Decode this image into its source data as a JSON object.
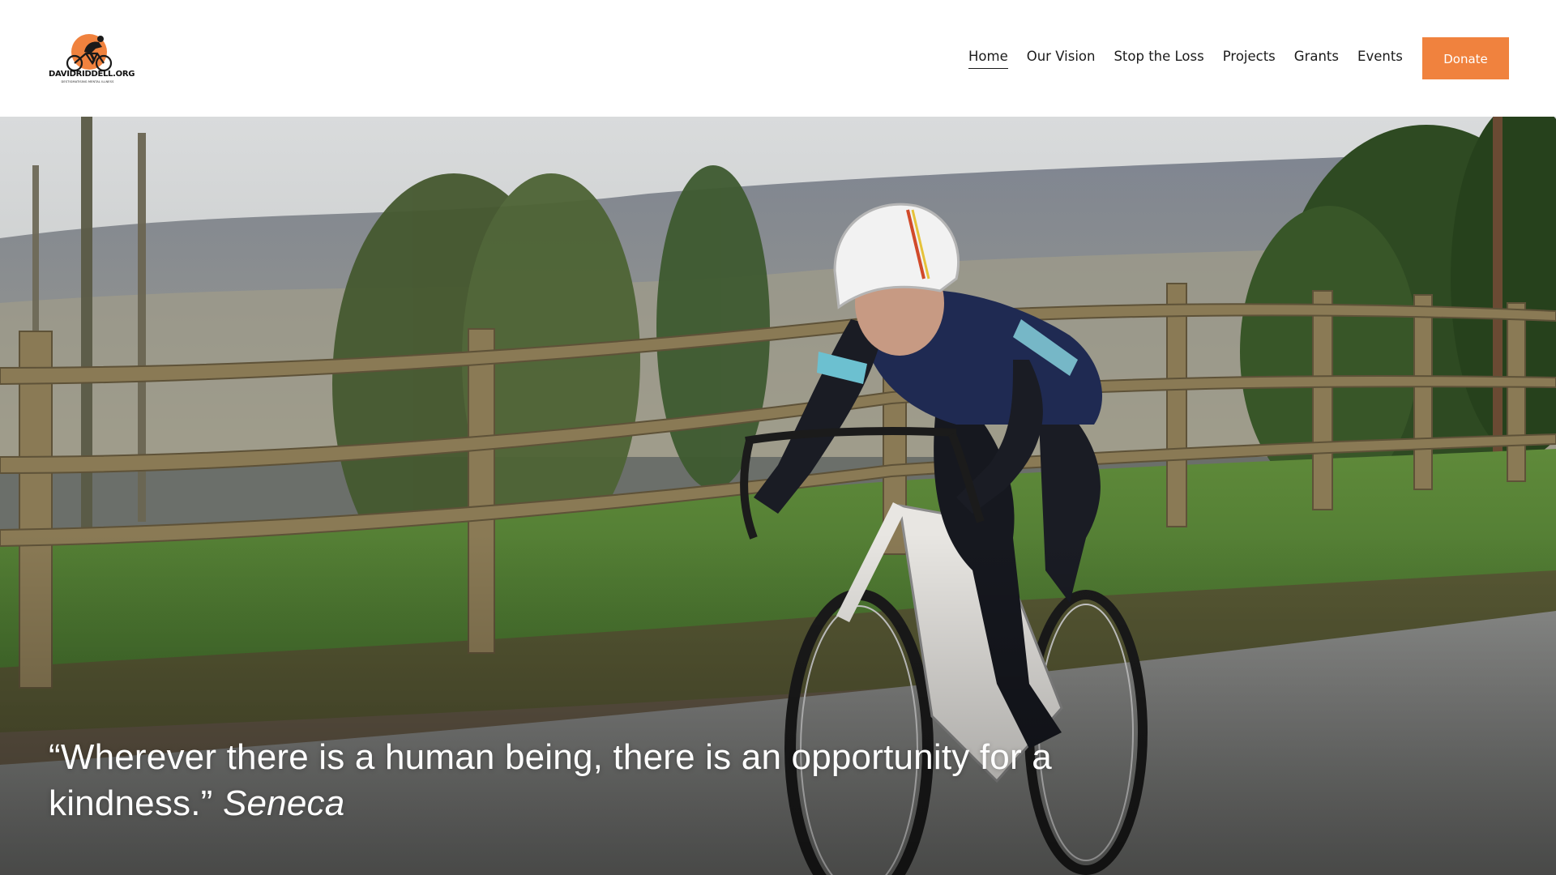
{
  "site": {
    "logo_text": "DAVIDRIDDELL.ORG",
    "logo_tagline": "DESTIGMATISING MENTAL ILLNESS"
  },
  "nav": {
    "items": [
      {
        "label": "Home",
        "active": true
      },
      {
        "label": "Our Vision",
        "active": false
      },
      {
        "label": "Stop the Loss",
        "active": false
      },
      {
        "label": "Projects",
        "active": false
      },
      {
        "label": "Grants",
        "active": false
      },
      {
        "label": "Events",
        "active": false
      }
    ],
    "donate_label": "Donate"
  },
  "hero": {
    "image_description_icon": "cyclist-photo",
    "quote_text": "“Wherever there is a human being, there is an opportunity for a kindness.” ",
    "quote_author": "Seneca"
  },
  "colors": {
    "accent": "#f0823e",
    "nav_text": "#1b1b1b",
    "header_bg": "#ffffff",
    "quote_text": "#ffffff"
  }
}
